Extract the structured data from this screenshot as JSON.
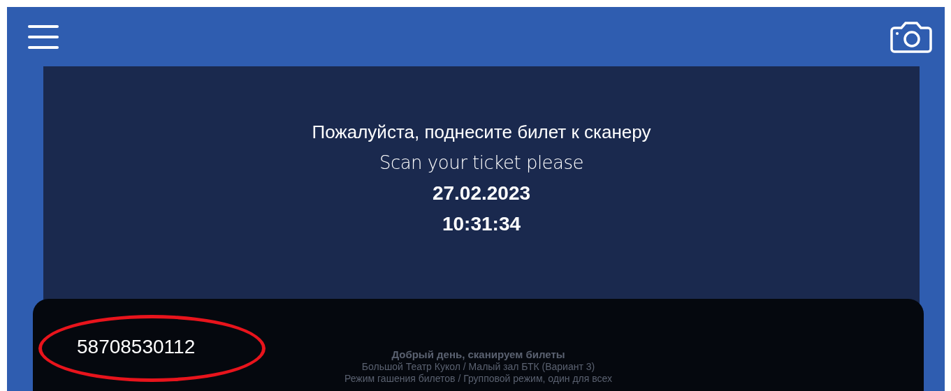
{
  "prompt": {
    "message_ru": "Пожалуйста, поднесите билет к сканеру",
    "message_en": "Scan your ticket please",
    "date": "27.02.2023",
    "time": "10:31:34"
  },
  "scan_overlay": {
    "scanned_code": "58708530112",
    "highlighted": true
  },
  "background_info": {
    "greeting": "Добрый день, сканируем билеты",
    "venue": "Большой Театр Кукол / Малый зал БТК (Вариант 3)",
    "mode": "Режим гашения билетов / Групповой режим, один для всех"
  }
}
